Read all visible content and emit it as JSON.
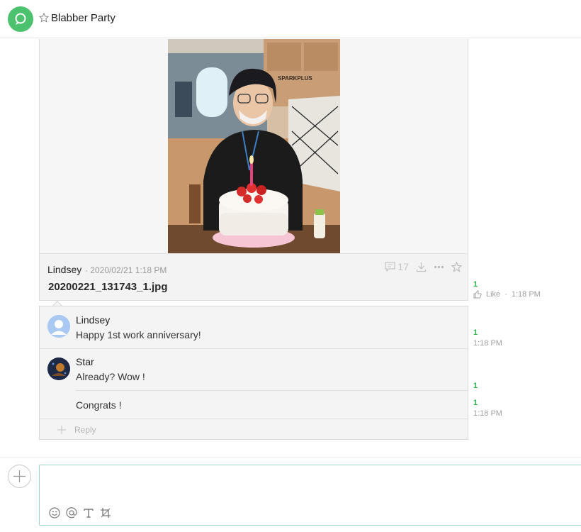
{
  "header": {
    "title": "Blabber Party",
    "app_icon": "chat-bubble-icon",
    "favorite_icon": "star-outline-icon"
  },
  "message": {
    "sender": "Lindsey",
    "timestamp": "· 2020/02/21 1:18 PM",
    "filename": "20200221_131743_1.jpg",
    "comment_count": "17",
    "unread_count": "1",
    "like_label": "Like",
    "like_time": "1:18 PM",
    "actions": [
      "comment-icon",
      "download-icon",
      "more-icon",
      "star-outline-icon"
    ],
    "photo": {
      "sign_text": "SPARKPLUS"
    }
  },
  "replies": [
    {
      "name": "Lindsey",
      "text": "Happy 1st work anniversary!",
      "unread": "1",
      "time": "1:18 PM"
    },
    {
      "name": "Star",
      "text": "Already? Wow !",
      "unread": "1",
      "time": ""
    },
    {
      "name": "",
      "text": "Congrats !",
      "unread": "1",
      "time": "1:18 PM"
    }
  ],
  "reply_button": {
    "label": "Reply"
  },
  "composer": {
    "tools": [
      "emoji-icon",
      "mention-icon",
      "text-format-icon",
      "crop-icon"
    ]
  },
  "colors": {
    "accent_green": "#4cc26e",
    "unread_green": "#2bb24c",
    "composer_border": "#9fd3c4"
  }
}
